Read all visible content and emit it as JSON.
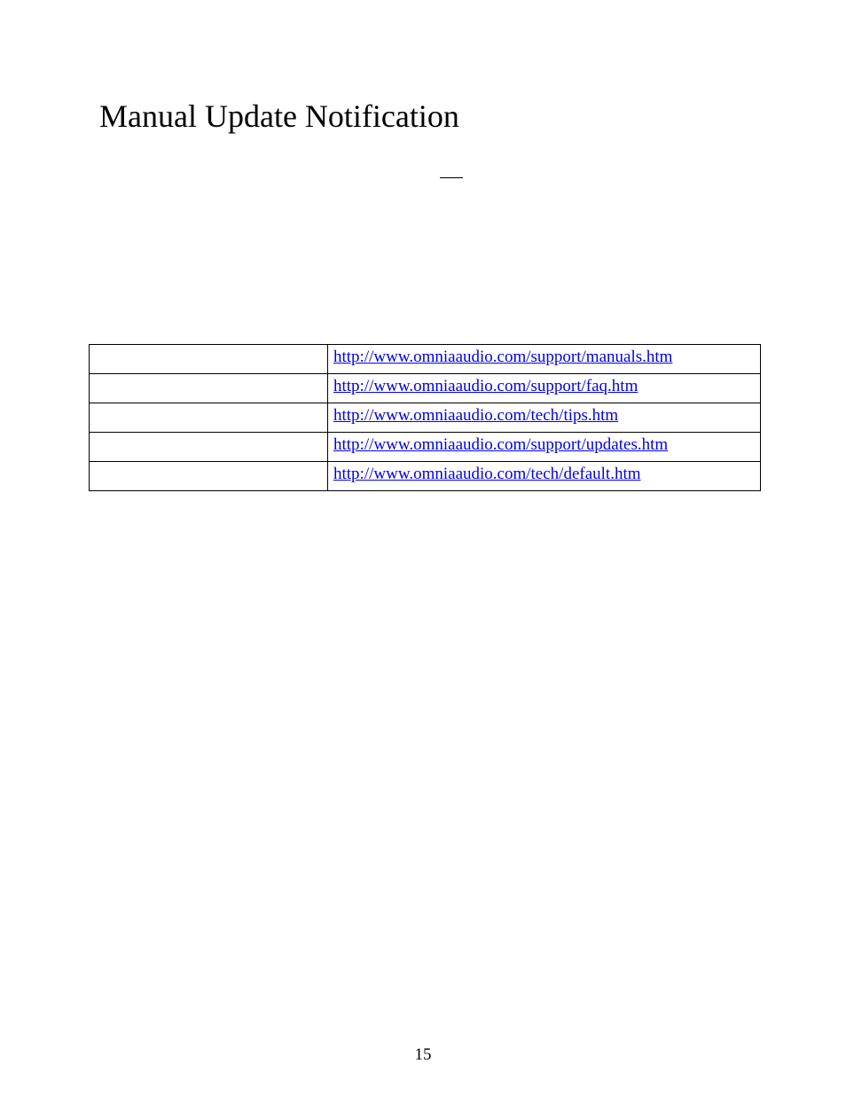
{
  "title": "Manual Update Notification",
  "links": [
    {
      "label": "",
      "url": "http://www.omniaaudio.com/support/manuals.htm"
    },
    {
      "label": "",
      "url": "http://www.omniaaudio.com/support/faq.htm"
    },
    {
      "label": "",
      "url": "http://www.omniaaudio.com/tech/tips.htm"
    },
    {
      "label": "",
      "url": "http://www.omniaaudio.com/support/updates.htm"
    },
    {
      "label": "",
      "url": "http://www.omniaaudio.com/tech/default.htm"
    }
  ],
  "page_number": "15"
}
